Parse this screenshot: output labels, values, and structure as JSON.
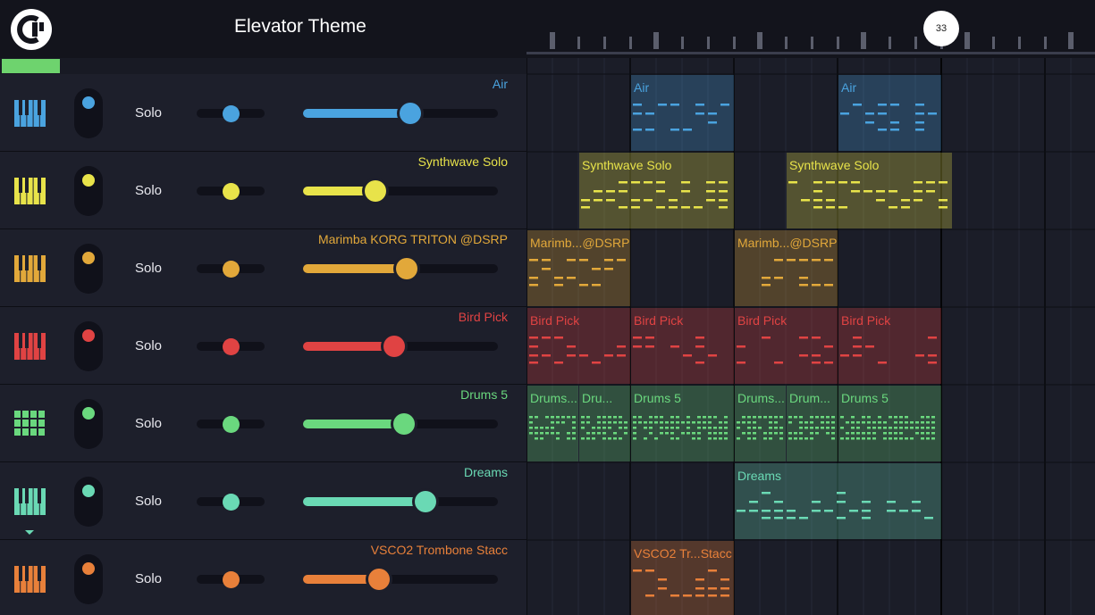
{
  "header": {
    "title": "Elevator Theme",
    "playhead_bar": "33"
  },
  "tracks": [
    {
      "name": "Air",
      "solo": "Solo",
      "color": "#4aa3df",
      "icon": "piano-icon",
      "pan": 0.5,
      "volume": 0.55
    },
    {
      "name": "Synthwave Solo",
      "solo": "Solo",
      "color": "#e8e34a",
      "icon": "piano-icon",
      "pan": 0.5,
      "volume": 0.37
    },
    {
      "name": "Marimba KORG TRITON @DSRP",
      "solo": "Solo",
      "color": "#e2a83a",
      "icon": "piano-icon",
      "pan": 0.5,
      "volume": 0.53
    },
    {
      "name": "Bird Pick",
      "solo": "Solo",
      "color": "#e04343",
      "icon": "piano-icon",
      "pan": 0.5,
      "volume": 0.47
    },
    {
      "name": "Drums 5",
      "solo": "Solo",
      "color": "#6ad87e",
      "icon": "drum-pad-icon",
      "pan": 0.5,
      "volume": 0.52
    },
    {
      "name": "Dreams",
      "solo": "Solo",
      "color": "#6ad9b4",
      "icon": "piano-icon",
      "pan": 0.5,
      "volume": 0.63
    },
    {
      "name": "VSCO2 Trombone Stacc",
      "solo": "Solo",
      "color": "#e8803a",
      "icon": "piano-icon",
      "pan": 0.5,
      "volume": 0.39
    }
  ],
  "clips": [
    {
      "track": 0,
      "start": 1,
      "len": 1,
      "label": "Air"
    },
    {
      "track": 0,
      "start": 3,
      "len": 1,
      "label": "Air"
    },
    {
      "track": 1,
      "start": 0.5,
      "len": 1.5,
      "label": "Synthwave Solo"
    },
    {
      "track": 1,
      "start": 2.5,
      "len": 1.6,
      "label": "Synthwave Solo"
    },
    {
      "track": 2,
      "start": 0,
      "len": 1,
      "label": "Marimb...@DSRP"
    },
    {
      "track": 2,
      "start": 2,
      "len": 1,
      "label": "Marimb...@DSRP"
    },
    {
      "track": 3,
      "start": 0,
      "len": 1,
      "label": "Bird Pick"
    },
    {
      "track": 3,
      "start": 1,
      "len": 1,
      "label": "Bird Pick"
    },
    {
      "track": 3,
      "start": 2,
      "len": 1,
      "label": "Bird Pick"
    },
    {
      "track": 3,
      "start": 3,
      "len": 1,
      "label": "Bird Pick"
    },
    {
      "track": 4,
      "start": 0,
      "len": 0.5,
      "label": "Drums..."
    },
    {
      "track": 4,
      "start": 0.5,
      "len": 0.5,
      "label": "Dru..."
    },
    {
      "track": 4,
      "start": 1,
      "len": 1,
      "label": "Drums 5"
    },
    {
      "track": 4,
      "start": 2,
      "len": 0.5,
      "label": "Drums..."
    },
    {
      "track": 4,
      "start": 2.5,
      "len": 0.5,
      "label": "Drum..."
    },
    {
      "track": 4,
      "start": 3,
      "len": 1,
      "label": "Drums 5"
    },
    {
      "track": 5,
      "start": 2,
      "len": 2,
      "label": "Dreams"
    },
    {
      "track": 6,
      "start": 1,
      "len": 1,
      "label": "VSCO2 Tr...Stacc"
    }
  ]
}
